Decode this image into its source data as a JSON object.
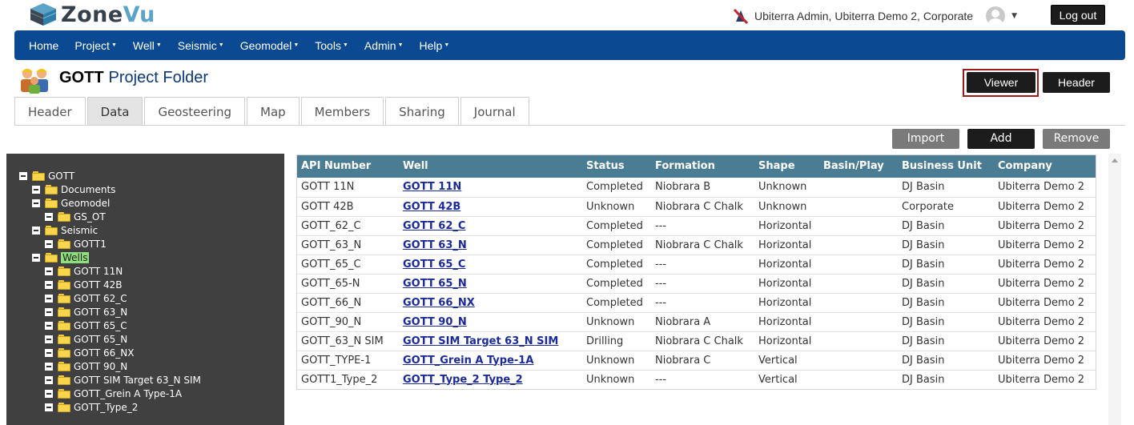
{
  "app": {
    "logo_main": "Zone",
    "logo_accent": "Vu"
  },
  "user": {
    "text": "Ubiterra Admin, Ubiterra Demo 2, Corporate",
    "logout_label": "Log out"
  },
  "nav": {
    "items": [
      {
        "label": "Home",
        "has_menu": false
      },
      {
        "label": "Project",
        "has_menu": true
      },
      {
        "label": "Well",
        "has_menu": true
      },
      {
        "label": "Seismic",
        "has_menu": true
      },
      {
        "label": "Geomodel",
        "has_menu": true
      },
      {
        "label": "Tools",
        "has_menu": true
      },
      {
        "label": "Admin",
        "has_menu": true
      },
      {
        "label": "Help",
        "has_menu": true
      }
    ]
  },
  "project": {
    "name": "GOTT",
    "subtitle": "Project Folder"
  },
  "view_buttons": {
    "viewer": "Viewer",
    "header": "Header"
  },
  "tabs": [
    {
      "label": "Header",
      "active": false
    },
    {
      "label": "Data",
      "active": true
    },
    {
      "label": "Geosteering",
      "active": false
    },
    {
      "label": "Map",
      "active": false
    },
    {
      "label": "Members",
      "active": false
    },
    {
      "label": "Sharing",
      "active": false
    },
    {
      "label": "Journal",
      "active": false
    }
  ],
  "toolbar": {
    "import": "Import",
    "add": "Add",
    "remove": "Remove"
  },
  "tree": [
    {
      "label": "GOTT",
      "level": 0,
      "selected": false
    },
    {
      "label": "Documents",
      "level": 1,
      "selected": false
    },
    {
      "label": "Geomodel",
      "level": 1,
      "selected": false
    },
    {
      "label": "GS_OT",
      "level": 2,
      "selected": false
    },
    {
      "label": "Seismic",
      "level": 1,
      "selected": false
    },
    {
      "label": "GOTT1",
      "level": 2,
      "selected": false
    },
    {
      "label": "Wells",
      "level": 1,
      "selected": true
    },
    {
      "label": "GOTT 11N",
      "level": 2,
      "selected": false
    },
    {
      "label": "GOTT 42B",
      "level": 2,
      "selected": false
    },
    {
      "label": "GOTT 62_C",
      "level": 2,
      "selected": false
    },
    {
      "label": "GOTT 63_N",
      "level": 2,
      "selected": false
    },
    {
      "label": "GOTT 65_C",
      "level": 2,
      "selected": false
    },
    {
      "label": "GOTT 65_N",
      "level": 2,
      "selected": false
    },
    {
      "label": "GOTT 66_NX",
      "level": 2,
      "selected": false
    },
    {
      "label": "GOTT 90_N",
      "level": 2,
      "selected": false
    },
    {
      "label": "GOTT SIM Target 63_N SIM",
      "level": 2,
      "selected": false
    },
    {
      "label": "GOTT_Grein A Type-1A",
      "level": 2,
      "selected": false
    },
    {
      "label": "GOTT_Type_2",
      "level": 2,
      "selected": false
    }
  ],
  "table": {
    "headers": [
      "API Number",
      "Well",
      "Status",
      "Formation",
      "Shape",
      "Basin/Play",
      "Business Unit",
      "Company"
    ],
    "rows": [
      [
        "GOTT 11N",
        "GOTT 11N",
        "Completed",
        "Niobrara B",
        "Unknown",
        "",
        "DJ Basin",
        "Ubiterra Demo 2"
      ],
      [
        "GOTT 42B",
        "GOTT 42B",
        "Unknown",
        "Niobrara C Chalk",
        "Unknown",
        "",
        "Corporate",
        "Ubiterra Demo 2"
      ],
      [
        "GOTT_62_C",
        "GOTT 62_C",
        "Completed",
        "---",
        "Horizontal",
        "",
        "DJ Basin",
        "Ubiterra Demo 2"
      ],
      [
        "GOTT_63_N",
        "GOTT 63_N",
        "Completed",
        "Niobrara C Chalk",
        "Horizontal",
        "",
        "DJ Basin",
        "Ubiterra Demo 2"
      ],
      [
        "GOTT_65_C",
        "GOTT 65_C",
        "Completed",
        "---",
        "Horizontal",
        "",
        "DJ Basin",
        "Ubiterra Demo 2"
      ],
      [
        "GOTT_65-N",
        "GOTT 65_N",
        "Completed",
        "---",
        "Horizontal",
        "",
        "DJ Basin",
        "Ubiterra Demo 2"
      ],
      [
        "GOTT_66_N",
        "GOTT 66_NX",
        "Completed",
        "---",
        "Horizontal",
        "",
        "DJ Basin",
        "Ubiterra Demo 2"
      ],
      [
        "GOTT_90_N",
        "GOTT 90_N",
        "Unknown",
        "Niobrara A",
        "Horizontal",
        "",
        "DJ Basin",
        "Ubiterra Demo 2"
      ],
      [
        "GOTT_63_N SIM",
        "GOTT SIM Target 63_N SIM",
        "Drilling",
        "Niobrara C Chalk",
        "Horizontal",
        "",
        "DJ Basin",
        "Ubiterra Demo 2"
      ],
      [
        "GOTT_TYPE-1",
        "GOTT_Grein A Type-1A",
        "Unknown",
        "Niobrara C",
        "Vertical",
        "",
        "DJ Basin",
        "Ubiterra Demo 2"
      ],
      [
        "GOTT1_Type_2",
        "GOTT_Type_2 Type_2",
        "Unknown",
        "---",
        "Vertical",
        "",
        "DJ Basin",
        "Ubiterra Demo 2"
      ]
    ]
  },
  "colors": {
    "nav": "#0b4a92",
    "table_header": "#4a7d94",
    "tree_bg": "#404040",
    "selected_node": "#8fe07b",
    "link": "#1a2a9a"
  }
}
